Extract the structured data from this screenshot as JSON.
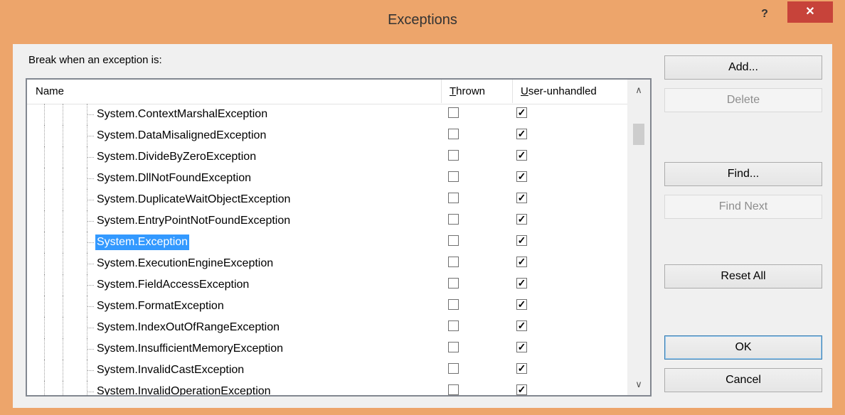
{
  "window": {
    "title": "Exceptions",
    "help_label": "?",
    "close_label": "✕"
  },
  "break_label": "Break when an exception is:",
  "list": {
    "columns": {
      "name": "Name",
      "thrown": "Thrown",
      "thrown_accel": "T",
      "thrown_rest": "hrown",
      "user_accel": "U",
      "user_rest": "ser-unhandled"
    },
    "rows": [
      {
        "name": "System.ContextMarshalException",
        "thrown": false,
        "user_unhandled": true,
        "selected": false
      },
      {
        "name": "System.DataMisalignedException",
        "thrown": false,
        "user_unhandled": true,
        "selected": false
      },
      {
        "name": "System.DivideByZeroException",
        "thrown": false,
        "user_unhandled": true,
        "selected": false
      },
      {
        "name": "System.DllNotFoundException",
        "thrown": false,
        "user_unhandled": true,
        "selected": false
      },
      {
        "name": "System.DuplicateWaitObjectException",
        "thrown": false,
        "user_unhandled": true,
        "selected": false
      },
      {
        "name": "System.EntryPointNotFoundException",
        "thrown": false,
        "user_unhandled": true,
        "selected": false
      },
      {
        "name": "System.Exception",
        "thrown": false,
        "user_unhandled": true,
        "selected": true
      },
      {
        "name": "System.ExecutionEngineException",
        "thrown": false,
        "user_unhandled": true,
        "selected": false
      },
      {
        "name": "System.FieldAccessException",
        "thrown": false,
        "user_unhandled": true,
        "selected": false
      },
      {
        "name": "System.FormatException",
        "thrown": false,
        "user_unhandled": true,
        "selected": false
      },
      {
        "name": "System.IndexOutOfRangeException",
        "thrown": false,
        "user_unhandled": true,
        "selected": false
      },
      {
        "name": "System.InsufficientMemoryException",
        "thrown": false,
        "user_unhandled": true,
        "selected": false
      },
      {
        "name": "System.InvalidCastException",
        "thrown": false,
        "user_unhandled": true,
        "selected": false
      },
      {
        "name": "System.InvalidOperationException",
        "thrown": false,
        "user_unhandled": true,
        "selected": false
      }
    ],
    "scroll_up_icon": "chevron-up-icon",
    "scroll_down_icon": "chevron-down-icon"
  },
  "buttons": {
    "add": "Add...",
    "delete": "Delete",
    "find": "Find...",
    "find_next": "Find Next",
    "reset_all": "Reset All",
    "ok": "OK",
    "cancel": "Cancel"
  },
  "colors": {
    "frame": "#eda56b",
    "close": "#c7433a",
    "selection": "#3399ff"
  }
}
